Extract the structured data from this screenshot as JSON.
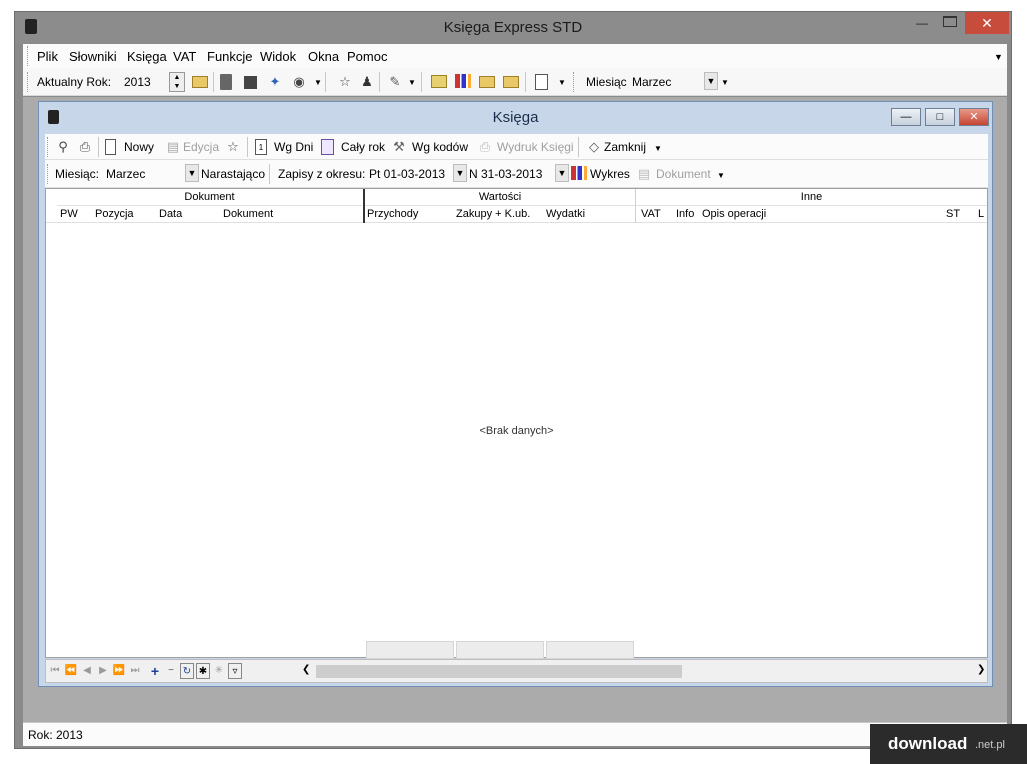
{
  "window": {
    "title": "Księga Express STD"
  },
  "menu": [
    "Plik",
    "Słowniki",
    "Księga",
    "VAT",
    "Funkcje",
    "Widok",
    "Okna",
    "Pomoc"
  ],
  "toolbar": {
    "year_label": "Aktualny Rok:",
    "year_value": "2013",
    "month_label": "Miesiąc",
    "month_value": "Marzec"
  },
  "child": {
    "title": "Księga",
    "toolbar1": {
      "new": "Nowy",
      "edit": "Edycja",
      "by_days": "Wg Dni",
      "whole_year": "Cały rok",
      "by_codes": "Wg kodów",
      "print": "Wydruk Księgi",
      "close": "Zamknij"
    },
    "toolbar2": {
      "month_label": "Miesiąc:",
      "month_value": "Marzec",
      "cumulative": "Narastająco",
      "period_label": "Zapisy z okresu:",
      "date_from": "Pt 01-03-2013",
      "date_to": "N 31-03-2013",
      "chart": "Wykres",
      "document": "Dokument"
    }
  },
  "grid": {
    "groups": [
      "Dokument",
      "Wartości",
      "Inne"
    ],
    "columns": [
      "PW",
      "Pozycja",
      "Data",
      "Dokument",
      "Przychody",
      "Zakupy + K.ub.",
      "Wydatki",
      "VAT",
      "Info",
      "Opis operacji",
      "ST",
      "L"
    ],
    "empty": "<Brak danych>"
  },
  "status": {
    "text": "Rok: 2013"
  },
  "watermark": {
    "brand": "download",
    "suffix": ".net.pl"
  }
}
